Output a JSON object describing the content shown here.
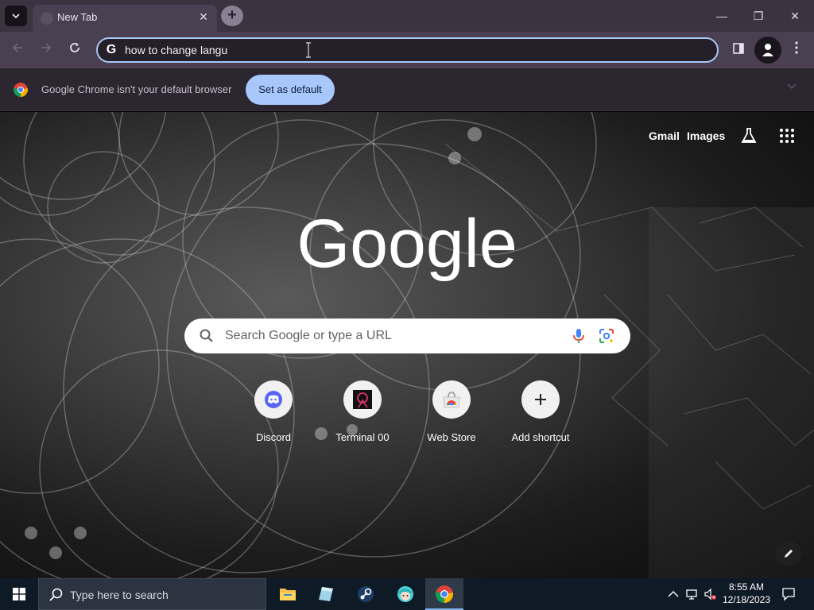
{
  "tabstrip": {
    "tab_title": "New Tab",
    "close_glyph": "✕",
    "new_tab_glyph": "+"
  },
  "window_controls": {
    "minimize": "—",
    "restore": "❐",
    "close": "✕"
  },
  "omnibox": {
    "value": "how to change langu",
    "g_glyph": "G"
  },
  "infobar": {
    "message": "Google Chrome isn't your default browser",
    "button_label": "Set as default"
  },
  "ntp": {
    "links": {
      "gmail": "Gmail",
      "images": "Images"
    },
    "logo": "Google",
    "search_placeholder": "Search Google or type a URL",
    "shortcuts": [
      {
        "label": "Discord",
        "icon": "discord-icon"
      },
      {
        "label": "Terminal 00",
        "icon": "terminal00-icon"
      },
      {
        "label": "Web Store",
        "icon": "web-store-icon"
      },
      {
        "label": "Add shortcut",
        "icon": "plus-icon"
      }
    ]
  },
  "taskbar": {
    "search_placeholder": "Type here to search",
    "apps": [
      "file-explorer-icon",
      "sticky-app-icon",
      "steam-icon",
      "character-app-icon",
      "chrome-icon"
    ],
    "time": "8:55 AM",
    "date": "12/18/2023"
  },
  "colors": {
    "accent": "#a8c7fa",
    "frame": "#3b3340",
    "toolbar": "#4a4052",
    "infobar": "#2c2630",
    "taskbar": "#0f1a27"
  }
}
